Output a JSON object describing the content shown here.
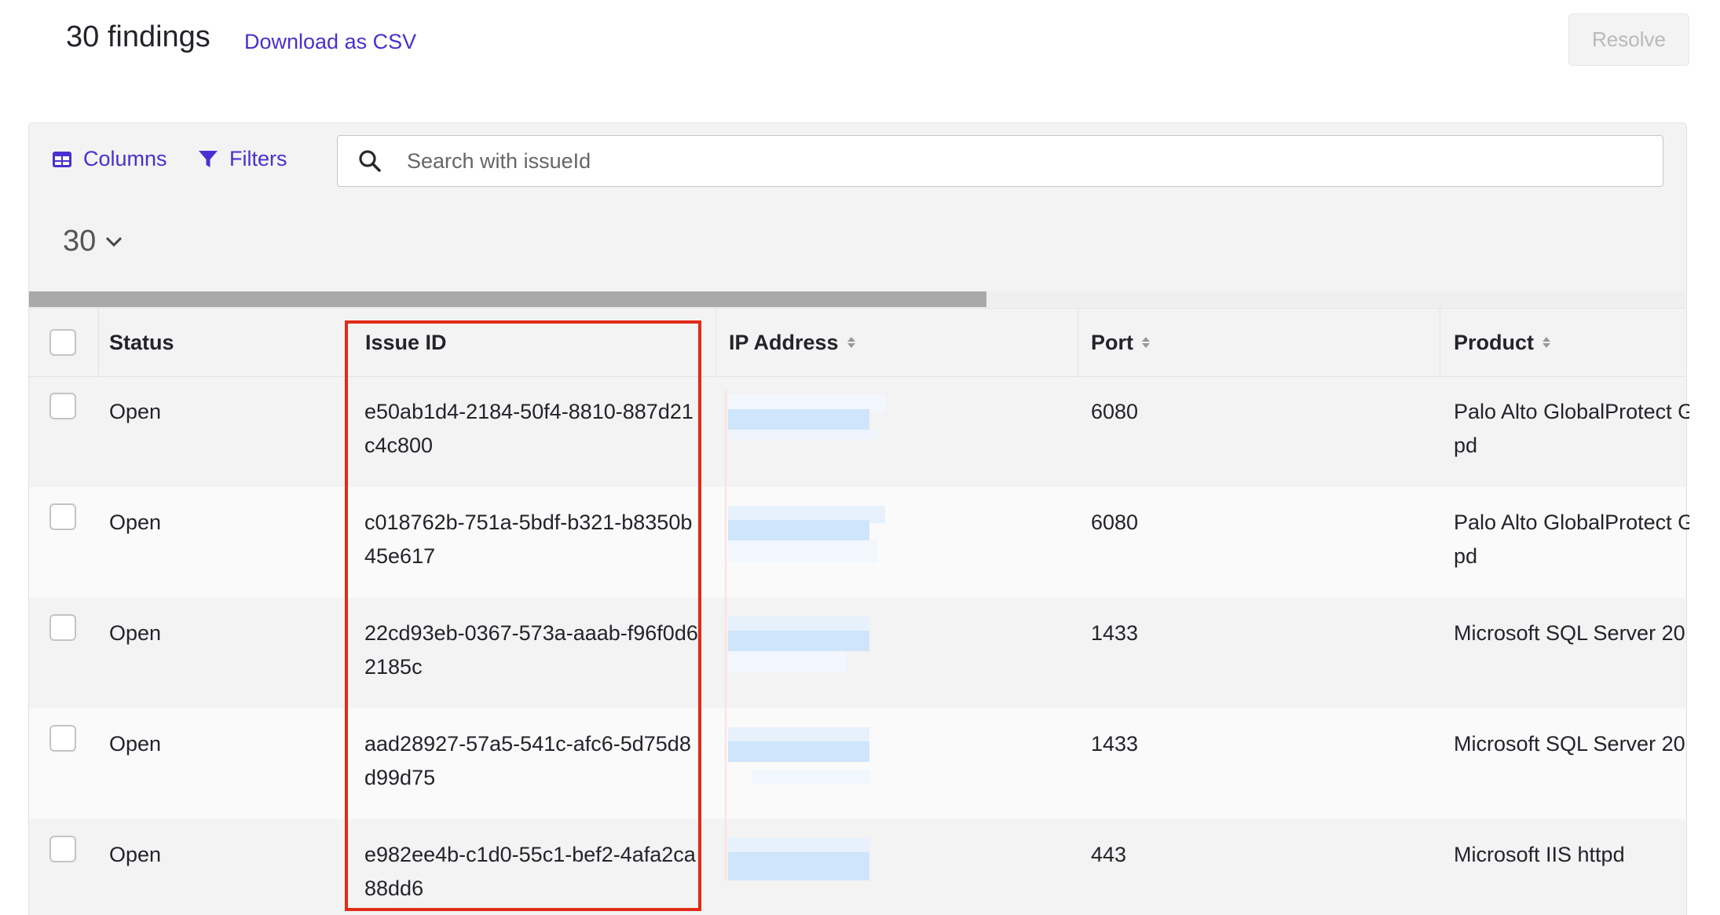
{
  "header": {
    "findings_count": "30 findings",
    "download_label": "Download as CSV",
    "resolve_label": "Resolve"
  },
  "toolbar": {
    "columns_label": "Columns",
    "filters_label": "Filters",
    "search_placeholder": "Search with issueId",
    "page_size": "30"
  },
  "table": {
    "columns": [
      "Status",
      "Issue ID",
      "IP Address",
      "Port",
      "Product"
    ],
    "rows": [
      {
        "status": "Open",
        "issue_id": "e50ab1d4-2184-50f4-8810-887d21c4c800",
        "port": "6080",
        "product_l1": "Palo Alto GlobalProtect G",
        "product_l2": "pd"
      },
      {
        "status": "Open",
        "issue_id": "c018762b-751a-5bdf-b321-b8350b45e617",
        "port": "6080",
        "product_l1": "Palo Alto GlobalProtect G",
        "product_l2": "pd"
      },
      {
        "status": "Open",
        "issue_id": "22cd93eb-0367-573a-aaab-f96f0d62185c",
        "port": "1433",
        "product_l1": "Microsoft SQL Server 20",
        "product_l2": ""
      },
      {
        "status": "Open",
        "issue_id": "aad28927-57a5-541c-afc6-5d75d8d99d75",
        "port": "1433",
        "product_l1": "Microsoft SQL Server 20",
        "product_l2": ""
      },
      {
        "status": "Open",
        "issue_id": "e982ee4b-c1d0-55c1-bef2-4afa2ca88dd6",
        "port": "443",
        "product_l1": "Microsoft IIS httpd",
        "product_l2": ""
      }
    ]
  },
  "colors": {
    "accent": "#4a2fd1",
    "highlight_box": "#e12b16"
  },
  "icons": {
    "columns": "table-grid-icon",
    "filters": "funnel-icon",
    "search": "magnifier-icon",
    "page_size": "chevron-down-icon",
    "sort": "sort-arrows-icon"
  }
}
